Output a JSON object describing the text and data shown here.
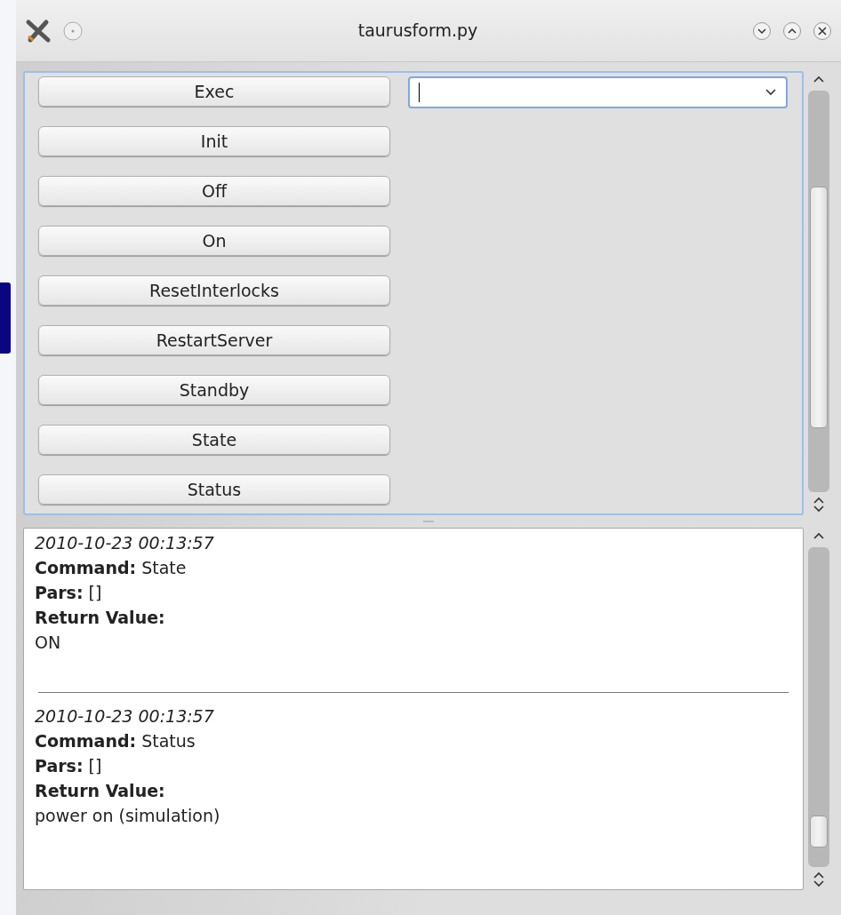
{
  "window": {
    "title": "taurusform.py"
  },
  "commands": [
    {
      "label": "Exec"
    },
    {
      "label": "Init"
    },
    {
      "label": "Off"
    },
    {
      "label": "On"
    },
    {
      "label": "ResetInterlocks"
    },
    {
      "label": "RestartServer"
    },
    {
      "label": "Standby"
    },
    {
      "label": "State"
    },
    {
      "label": "Status"
    }
  ],
  "log": [
    {
      "timestamp": "2010-10-23 00:13:57",
      "command": "**Command:** State",
      "pars": "**Pars:** []",
      "return_label": "Return Value:",
      "return_value": "ON"
    },
    {
      "timestamp": "2010-10-23 00:13:57",
      "command": "**Command:** Status",
      "pars": "**Pars:** []",
      "return_label": "Return Value:",
      "return_value": "power on (simulation)"
    }
  ]
}
